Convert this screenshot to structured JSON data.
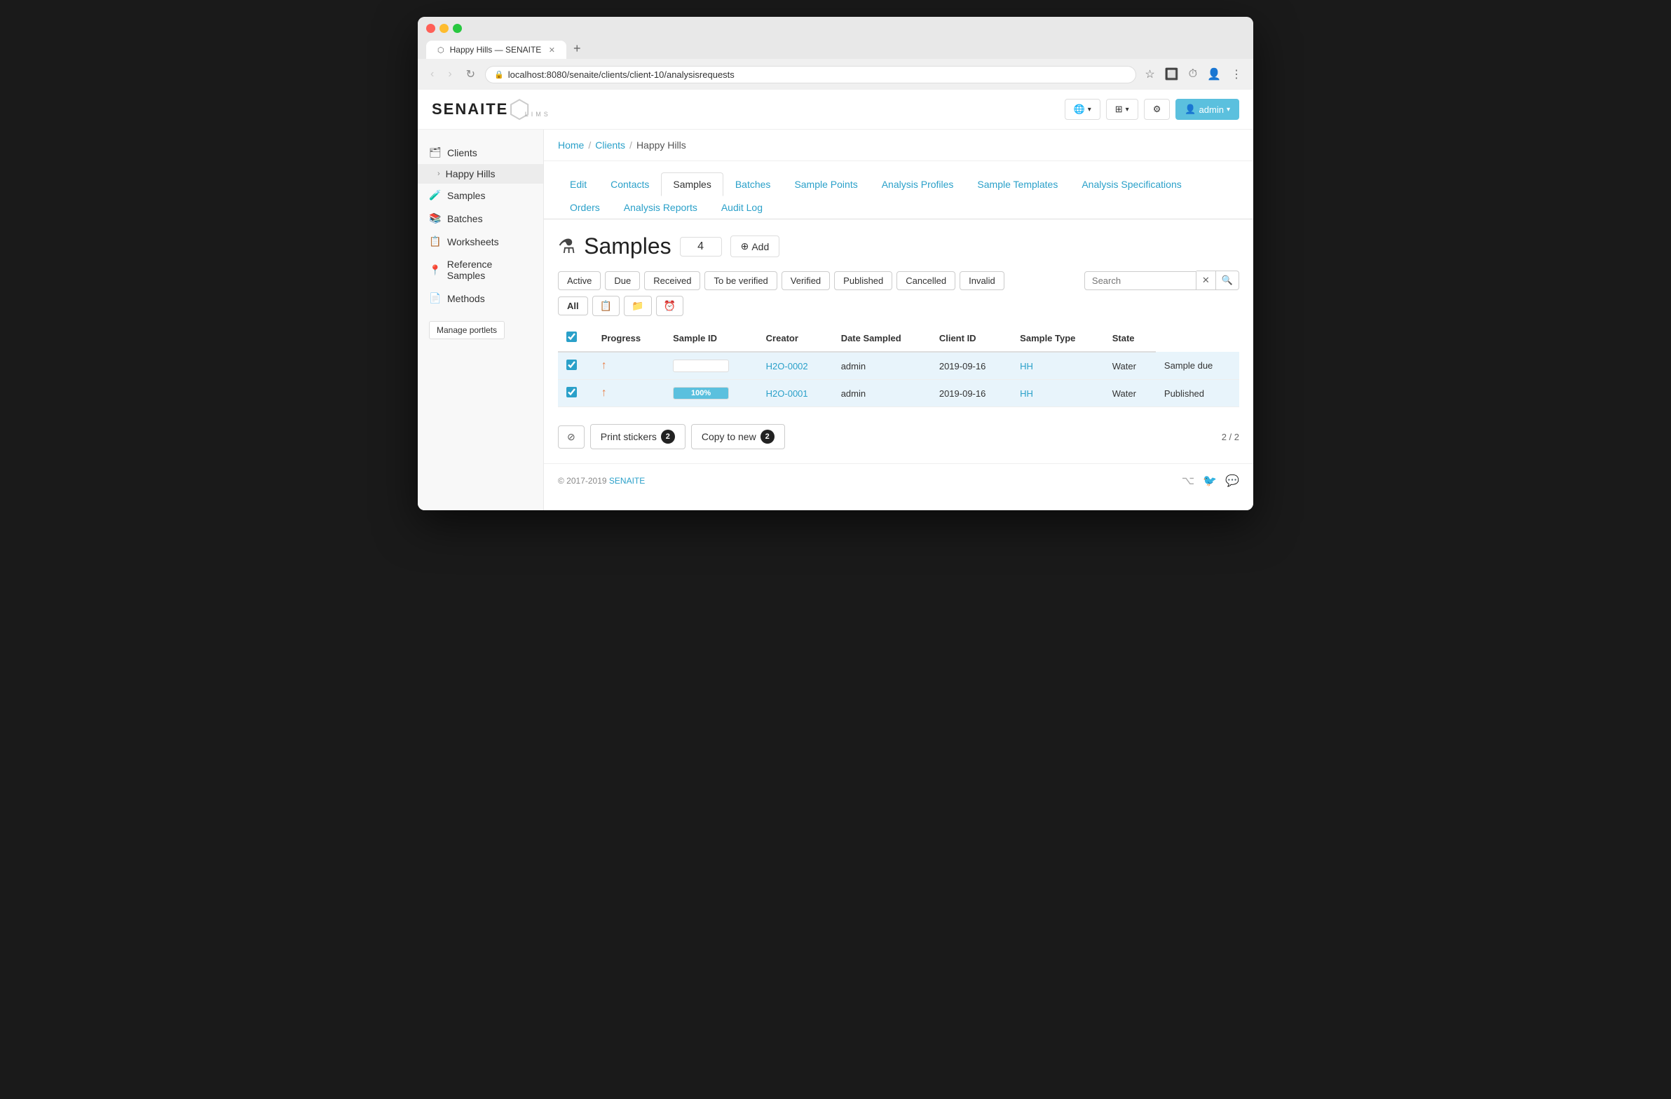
{
  "browser": {
    "tab_title": "Happy Hills — SENAITE",
    "url_display": "localhost:8080/senaite/clients/client-10/analysisrequests",
    "url_bold": "localhost",
    "url_rest": ":8080/senaite/clients/client-10/analysisrequests"
  },
  "header": {
    "logo_text": "SENAITE",
    "logo_sub": "LIMS",
    "globe_label": "🌐",
    "grid_label": "⊞",
    "gear_label": "⚙",
    "user_label": "admin"
  },
  "sidebar": {
    "items": [
      {
        "id": "clients",
        "label": "Clients",
        "icon": "🗂"
      },
      {
        "id": "happy-hills",
        "label": "Happy Hills",
        "icon": "›",
        "sub": true
      },
      {
        "id": "samples",
        "label": "Samples",
        "icon": "🧪"
      },
      {
        "id": "batches",
        "label": "Batches",
        "icon": "📚"
      },
      {
        "id": "worksheets",
        "label": "Worksheets",
        "icon": "📋"
      },
      {
        "id": "reference-samples",
        "label": "Reference Samples",
        "icon": "📍"
      },
      {
        "id": "methods",
        "label": "Methods",
        "icon": "📄"
      }
    ],
    "manage_portlets": "Manage portlets"
  },
  "breadcrumb": {
    "items": [
      {
        "label": "Home",
        "href": "#"
      },
      {
        "label": "Clients",
        "href": "#"
      },
      {
        "label": "Happy Hills",
        "current": true
      }
    ]
  },
  "tabs": [
    {
      "id": "edit",
      "label": "Edit",
      "active": false
    },
    {
      "id": "contacts",
      "label": "Contacts",
      "active": false
    },
    {
      "id": "samples",
      "label": "Samples",
      "active": true
    },
    {
      "id": "batches",
      "label": "Batches",
      "active": false
    },
    {
      "id": "sample-points",
      "label": "Sample Points",
      "active": false
    },
    {
      "id": "analysis-profiles",
      "label": "Analysis Profiles",
      "active": false
    },
    {
      "id": "sample-templates",
      "label": "Sample Templates",
      "active": false
    },
    {
      "id": "analysis-specifications",
      "label": "Analysis Specifications",
      "active": false
    },
    {
      "id": "orders",
      "label": "Orders",
      "active": false
    },
    {
      "id": "analysis-reports",
      "label": "Analysis Reports",
      "active": false
    },
    {
      "id": "audit-log",
      "label": "Audit Log",
      "active": false
    }
  ],
  "page": {
    "title": "Samples",
    "icon": "🧪",
    "count": "4",
    "add_label": "Add"
  },
  "filters": {
    "buttons": [
      {
        "id": "active",
        "label": "Active",
        "active": false
      },
      {
        "id": "due",
        "label": "Due",
        "active": false
      },
      {
        "id": "received",
        "label": "Received",
        "active": false
      },
      {
        "id": "to-be-verified",
        "label": "To be verified",
        "active": false
      },
      {
        "id": "verified",
        "label": "Verified",
        "active": false
      },
      {
        "id": "published",
        "label": "Published",
        "active": false
      },
      {
        "id": "cancelled",
        "label": "Cancelled",
        "active": false
      },
      {
        "id": "invalid",
        "label": "Invalid",
        "active": false
      }
    ],
    "search_placeholder": "Search"
  },
  "table": {
    "columns": [
      {
        "id": "checkbox",
        "label": ""
      },
      {
        "id": "progress",
        "label": "Progress"
      },
      {
        "id": "sample-id",
        "label": "Sample ID"
      },
      {
        "id": "creator",
        "label": "Creator"
      },
      {
        "id": "date-sampled",
        "label": "Date Sampled"
      },
      {
        "id": "client-id",
        "label": "Client ID"
      },
      {
        "id": "sample-type",
        "label": "Sample Type"
      },
      {
        "id": "state",
        "label": "State"
      }
    ],
    "rows": [
      {
        "id": "row1",
        "checked": true,
        "progress_pct": 0,
        "progress_label": "",
        "sample_id": "H2O-0002",
        "creator": "admin",
        "date_sampled": "2019-09-16",
        "client_id": "HH",
        "sample_type": "Water",
        "state": "Sample due",
        "selected": true
      },
      {
        "id": "row2",
        "checked": true,
        "progress_pct": 100,
        "progress_label": "100%",
        "sample_id": "H2O-0001",
        "creator": "admin",
        "date_sampled": "2019-09-16",
        "client_id": "HH",
        "sample_type": "Water",
        "state": "Published",
        "selected": true
      }
    ]
  },
  "bottom_actions": {
    "cancel_label": "⊘",
    "print_stickers_label": "Print stickers",
    "print_stickers_count": "2",
    "copy_to_new_label": "Copy to new",
    "copy_to_new_count": "2",
    "pagination": "2 / 2"
  },
  "footer": {
    "copyright": "© 2017-2019",
    "brand": "SENAITE"
  }
}
